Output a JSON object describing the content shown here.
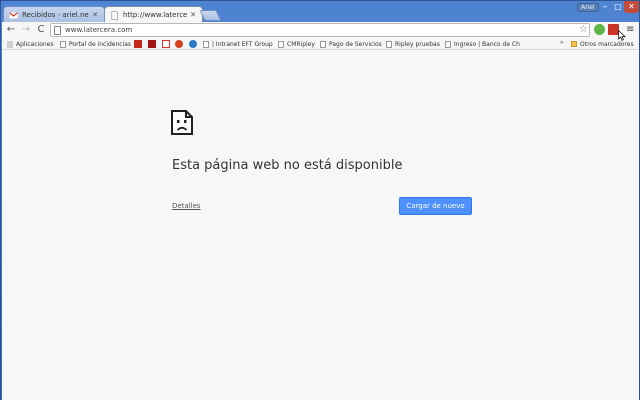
{
  "window": {
    "user_name": "Ariel",
    "controls": {
      "minimize": "‒",
      "maximize": "□",
      "close": "✕"
    }
  },
  "tabs": [
    {
      "title": "Recibidos - ariel.neira@",
      "icon": "gmail-icon",
      "active": false
    },
    {
      "title": "http://www.latercera.c",
      "icon": "page-icon",
      "active": true
    }
  ],
  "toolbar": {
    "url": "www.latercera.com",
    "back": "←",
    "forward": "→",
    "reload": "C",
    "star": "☆",
    "menu": "≡"
  },
  "bookmarks": {
    "items": [
      {
        "label": "Aplicaciones",
        "icon": "apps-icon"
      },
      {
        "label": "Portal de incidencias",
        "icon": "page-icon"
      },
      {
        "label": "| Intranet EFT Group",
        "icon": "page-icon"
      },
      {
        "label": "CMRipley",
        "icon": "page-icon"
      },
      {
        "label": "Pago de Servicios",
        "icon": "page-icon"
      },
      {
        "label": "Ripley pruebas",
        "icon": "page-icon"
      },
      {
        "label": "Ingreso | Banco de Ch",
        "icon": "page-icon"
      }
    ],
    "overflow": "»",
    "other": {
      "label": "Otros marcadores",
      "icon": "folder-icon"
    }
  },
  "error_page": {
    "title": "Esta página web no está disponible",
    "details_link": "Detalles",
    "reload_button": "Cargar de nuevo"
  },
  "colors": {
    "frame": "#4f84d3",
    "reload_button": "#4d90fe",
    "content_bg": "#f7f7f7"
  }
}
